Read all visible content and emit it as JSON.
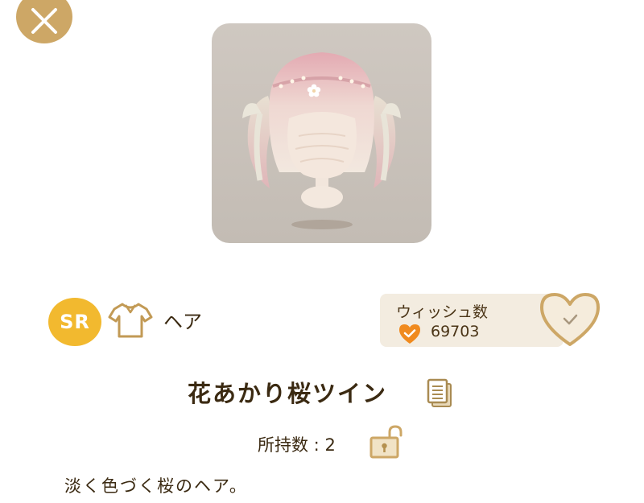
{
  "header": {
    "close_icon": "close-icon"
  },
  "item": {
    "rarity": "SR",
    "category_icon": "shirt-icon",
    "category": "ヘア",
    "name": "花あかり桜ツイン",
    "owned_label": "所持数",
    "owned_count": "2",
    "description": "淡く色づく桜のヘア。"
  },
  "wish": {
    "title": "ウィッシュ数",
    "count": "69703",
    "icon": "heart-check-icon",
    "button_icon": "heart-check-icon"
  },
  "actions": {
    "detail_icon": "document-icon",
    "lock_icon": "unlocked-padlock-icon"
  },
  "colors": {
    "accent_gold": "#cda766",
    "sr_badge": "#f2b92f",
    "wish_heart": "#f08a1e",
    "wish_box_bg": "#f3ece0",
    "text": "#3b2a12"
  }
}
